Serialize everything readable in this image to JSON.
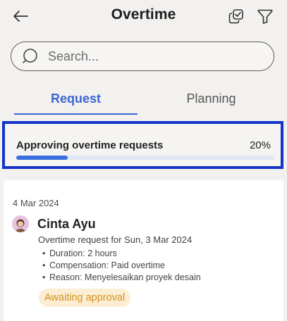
{
  "header": {
    "title": "Overtime",
    "back_icon": "arrow-left-icon",
    "copy_icon": "copy-icon",
    "filter_icon": "filter-icon"
  },
  "search": {
    "placeholder": "Search...",
    "value": "",
    "icon": "search-icon"
  },
  "tabs": [
    {
      "label": "Request",
      "active": true
    },
    {
      "label": "Planning",
      "active": false
    }
  ],
  "progress": {
    "label": "Approving overtime requests",
    "percent_text": "20%",
    "value": 0.2,
    "frame_color": "#1533c8",
    "fill_color": "#3b6fe0"
  },
  "request_card": {
    "date": "4 Mar 2024",
    "name": "Cinta Ayu",
    "subtitle": "Overtime request for Sun, 3 Mar 2024",
    "details": [
      "Duration: 2 hours",
      "Compensation: Paid overtime",
      "Reason: Menyelesaikan proyek desain"
    ],
    "status": "Awaiting approval",
    "status_color": "#d3921f"
  },
  "colors": {
    "accent": "#3a66d6",
    "background": "#f3f1ef"
  }
}
